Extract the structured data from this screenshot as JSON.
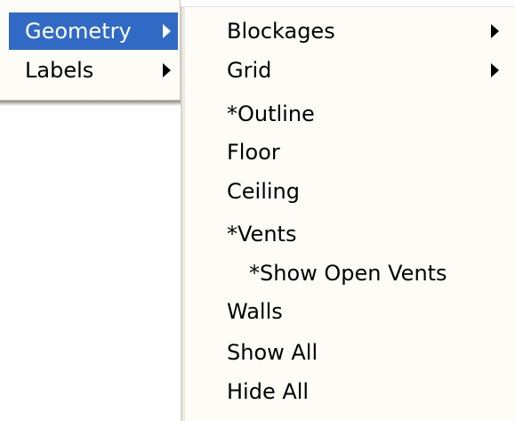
{
  "parent_menu": {
    "items": [
      {
        "label": "Geometry",
        "selected": true,
        "has_submenu": true
      },
      {
        "label": "Labels",
        "selected": false,
        "has_submenu": true
      }
    ]
  },
  "submenu": {
    "items": [
      {
        "label": "Blockages",
        "has_submenu": true
      },
      {
        "label": "Grid",
        "has_submenu": true
      },
      {
        "label": "*Outline"
      },
      {
        "label": "Floor"
      },
      {
        "label": "Ceiling"
      },
      {
        "label": "*Vents"
      },
      {
        "label": "*Show Open Vents",
        "indented": true
      },
      {
        "label": "Walls"
      },
      {
        "label": "Show All"
      },
      {
        "label": "Hide All"
      }
    ]
  },
  "colors": {
    "selection": "#316ac5",
    "menu_background": "#fdfcf7"
  },
  "icons": {
    "submenu_arrow": "chevron-right-icon"
  }
}
